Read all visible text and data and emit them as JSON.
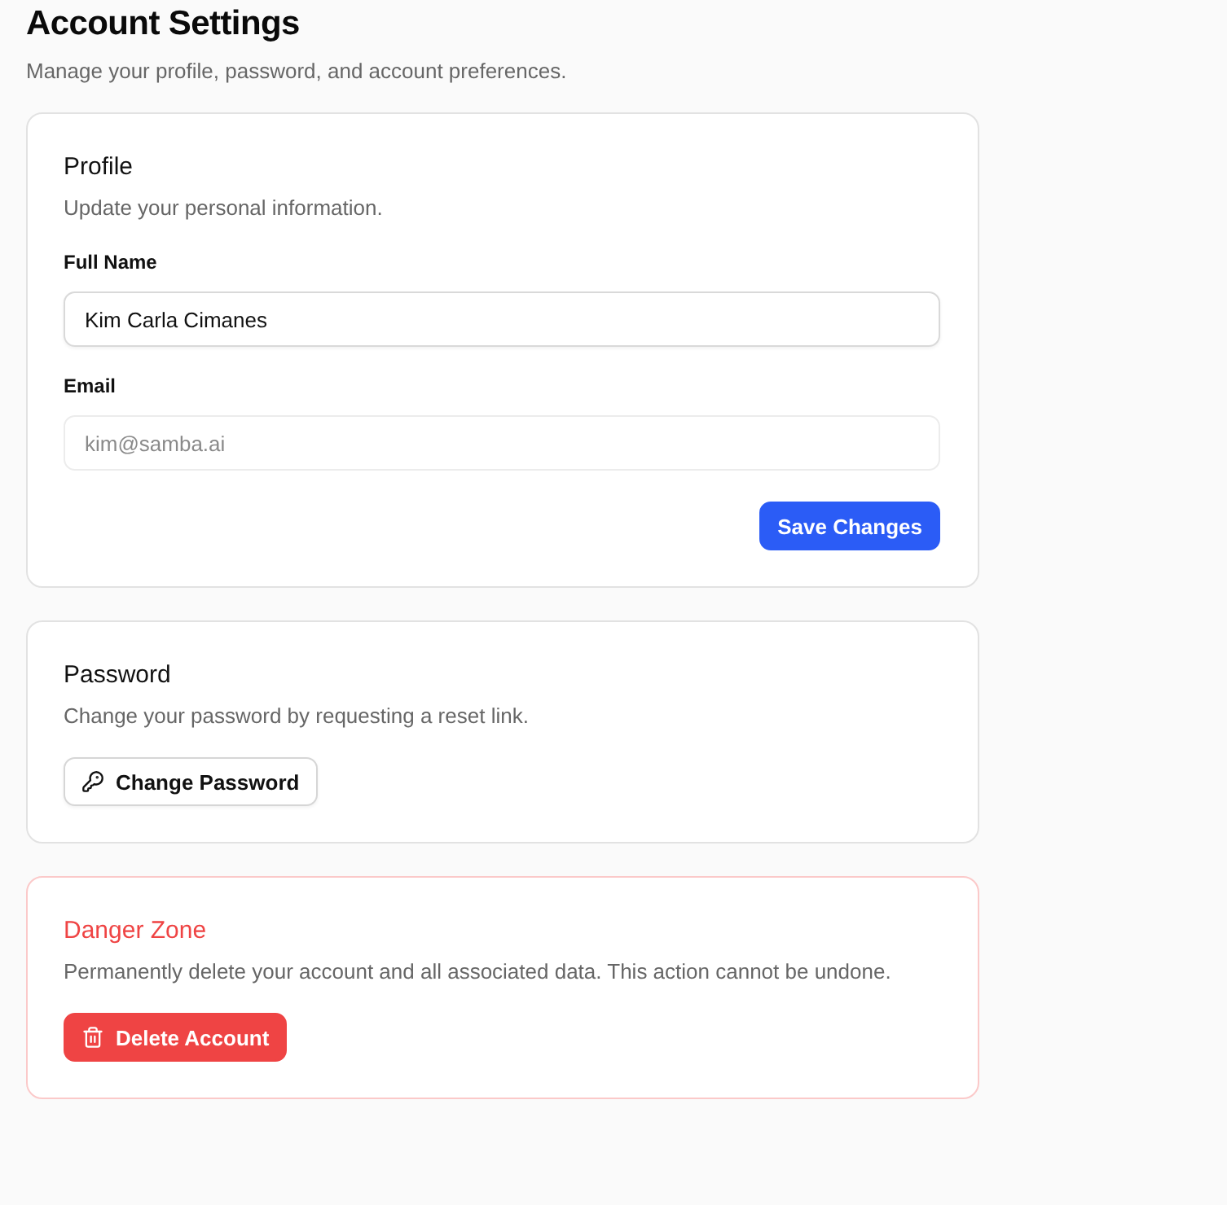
{
  "page": {
    "title": "Account Settings",
    "subtitle": "Manage your profile, password, and account preferences."
  },
  "sections": [
    {
      "kind": "profile",
      "title": "Profile",
      "description": "Update your personal information.",
      "fields": [
        {
          "label": "Full Name",
          "value": "Kim Carla Cimanes",
          "disabled": false
        },
        {
          "label": "Email",
          "value": "kim@samba.ai",
          "disabled": true
        }
      ],
      "actions": [
        {
          "label": "Save Changes",
          "kind": "primary"
        }
      ]
    },
    {
      "kind": "password",
      "title": "Password",
      "description": "Change your password by requesting a reset link.",
      "actions": [
        {
          "label": "Change Password",
          "kind": "outline"
        }
      ]
    },
    {
      "kind": "danger",
      "title": "Danger Zone",
      "description": "Permanently delete your account and all associated data. This action cannot be undone.",
      "actions": [
        {
          "label": "Delete Account",
          "kind": "destructive"
        }
      ]
    }
  ]
}
